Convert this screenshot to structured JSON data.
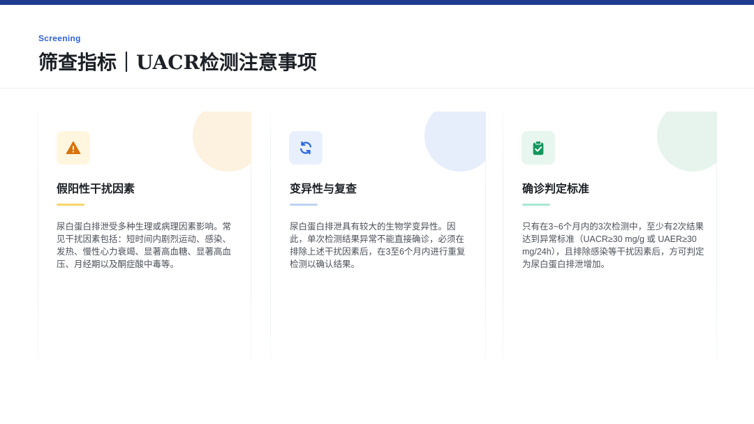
{
  "header": {
    "eyebrow": "Screening",
    "title": "筛查指标｜UACR检测注意事项"
  },
  "cards": [
    {
      "icon": "warning-icon",
      "title": "假阳性干扰因素",
      "text": "尿白蛋白排泄受多种生理或病理因素影响。常见干扰因素包括：短时间内剧烈运动、感染、发热、慢性心力衰竭、显著高血糖、显著高血压、月经期以及酮症酸中毒等。",
      "accent_color": "#f7d56a",
      "icon_color": "#d9730d"
    },
    {
      "icon": "refresh-icon",
      "title": "变异性与复查",
      "text": "尿白蛋白排泄具有较大的生物学变异性。因此，单次检测结果异常不能直接确诊，必须在排除上述干扰因素后，在3至6个月内进行重复检测以确认结果。",
      "accent_color": "#bcd2f3",
      "icon_color": "#2f6ae0"
    },
    {
      "icon": "clipboard-check-icon",
      "title": "确诊判定标准",
      "text": "只有在3~6个月内的3次检测中，至少有2次结果达到异常标准（UACR≥30 mg/g 或 UAER≥30 mg/24h），且排除感染等干扰因素后，方可判定为尿白蛋白排泄增加。",
      "accent_color": "#a8e7cc",
      "icon_color": "#14965e"
    }
  ]
}
